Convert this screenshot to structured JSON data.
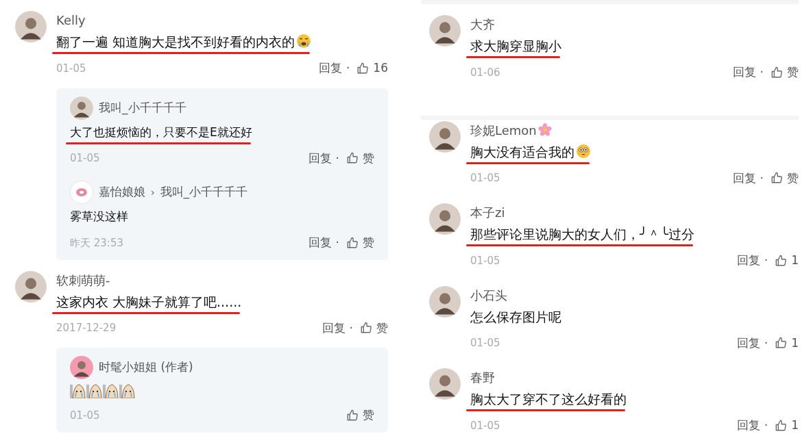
{
  "left_comments": [
    {
      "user": "Kelly",
      "avatar": {
        "kind": "photo"
      },
      "text": "翻了一遍 知道胸大是找不到好看的内衣的",
      "underlined": true,
      "emoji": {
        "kind": "crying"
      },
      "date": "01-05",
      "reply_label": "回复",
      "separator": "·",
      "like_label": "16",
      "replies": [
        {
          "user": "我叫_小千千千千",
          "avatar": {
            "kind": "photo"
          },
          "text": "大了也挺烦恼的，只要不是E就还好",
          "underlined": true,
          "date": "01-05",
          "reply_label": "回复",
          "separator": "·",
          "like_label": "赞"
        },
        {
          "user": "嘉怡娘娘",
          "avatar": {
            "kind": "donut"
          },
          "arrow": "›",
          "target": "我叫_小千千千千",
          "text": "雾草没这样",
          "underlined": false,
          "date": "昨天 23:53",
          "reply_label": "回复",
          "separator": "·",
          "like_label": "赞"
        }
      ]
    },
    {
      "user": "软刺萌萌-",
      "avatar": {
        "kind": "photo"
      },
      "text": "这家内衣 大胸妹子就算了吧......",
      "underlined": true,
      "date": "2017-12-29",
      "reply_label": "回复",
      "separator": "·",
      "like_label": "赞",
      "replies": [
        {
          "user": "时髦小姐姐 (作者)",
          "avatar": {
            "kind": "cartoon"
          },
          "stickers": [
            {
              "kind": "crying"
            },
            {
              "kind": "crying"
            },
            {
              "kind": "crying"
            },
            {
              "kind": "crying"
            }
          ],
          "date": "01-05",
          "like_label": "赞"
        }
      ]
    }
  ],
  "right_sections": [
    [
      {
        "user": "大齐",
        "avatar": {
          "kind": "photo"
        },
        "text": "求大胸穿显胸小",
        "underlined": true,
        "date": "01-06",
        "reply_label": "回复",
        "separator": "·",
        "like_label": "赞"
      }
    ],
    [
      {
        "user": "珍妮Lemon",
        "avatar": {
          "kind": "photo"
        },
        "name_emoji": {
          "kind": "flower"
        },
        "text": "胸大没有适合我的",
        "underlined": true,
        "emoji": {
          "kind": "flushed"
        },
        "date": "01-05",
        "reply_label": "回复",
        "separator": "·",
        "like_label": "赞"
      },
      {
        "user": "本子zi",
        "avatar": {
          "kind": "photo"
        },
        "text": "那些评论里说胸大的女人们，╯＾╰过分",
        "underlined": true,
        "date": "01-05",
        "reply_label": "回复",
        "separator": "·",
        "like_label": "1"
      },
      {
        "user": "小石头",
        "avatar": {
          "kind": "photo"
        },
        "text": "怎么保存图片呢",
        "underlined": false,
        "date": "01-05",
        "reply_label": "回复",
        "separator": "·",
        "like_label": "1"
      },
      {
        "user": "春野",
        "avatar": {
          "kind": "photo"
        },
        "text": "胸太大了穿不了这么好看的",
        "underlined": true,
        "date": "01-05",
        "reply_label": "回复",
        "separator": "·",
        "like_label": "1"
      }
    ]
  ]
}
